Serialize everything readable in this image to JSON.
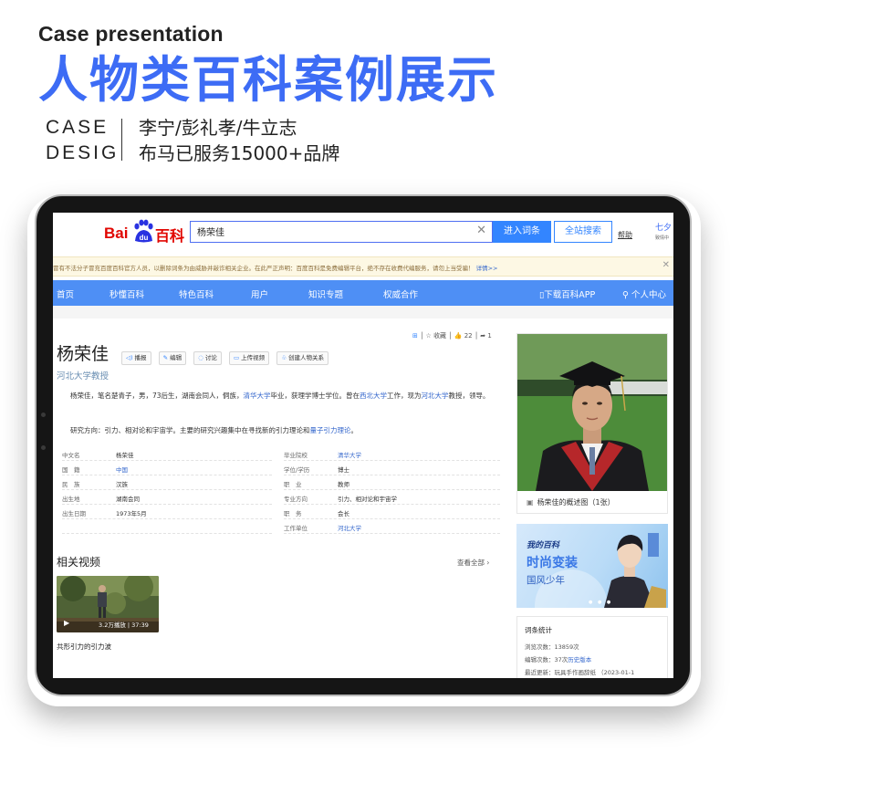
{
  "header": {
    "eyebrow": "Case presentation",
    "headline": "人物类百科案例展示",
    "case_line1": "CASE",
    "case_line2": "DESIG",
    "names": "李宁/彭礼孝/牛立志",
    "served": "布马已服务15000+品牌"
  },
  "baike": {
    "logo_bai": "Bai",
    "logo_du": "du",
    "logo_ke": "百科",
    "search_value": "杨荣佳",
    "enter_button": "进入词条",
    "all_search_button": "全站搜索",
    "help": "帮助",
    "top_right": "七夕",
    "top_right_sub": "致情中",
    "notice": "冒有不法分子冒充百度百科官方人员，以删除词条为由威胁并敲诈相关企业。在此严正声明：百度百科是免费编辑平台，绝不存在收费代编服务，请勿上当受骗！",
    "notice_more": "详情>>",
    "nav": {
      "items": [
        "首页",
        "秒懂百科",
        "特色百科",
        "用户",
        "知识专题",
        "权威合作"
      ],
      "download": "下载百科APP",
      "personal": "个人中心"
    },
    "meta": {
      "collect": "收藏",
      "likes": "22",
      "shares": "1"
    },
    "entry": {
      "name": "杨荣佳",
      "actions": [
        "播报",
        "编辑",
        "讨论",
        "上传视频",
        "创建人物关系"
      ],
      "subtitle": "河北大学教授",
      "intro": {
        "t1": "杨荣佳，笔名楚青子，男，73后生，湖南会同人，侗族，",
        "l1": "清华大学",
        "t2": "毕业，获理学博士学位。曾在",
        "l2": "西北大学",
        "t3": "工作，现为",
        "l3": "河北大学",
        "t4": "教授，领导。"
      },
      "research": {
        "t1": "研究方向：引力、相对论和宇宙学。主要的研究兴趣集中在寻找新的引力理论和",
        "l1": "量子引力理论",
        "t2": "。"
      },
      "info_left": [
        {
          "k": "中文名",
          "v": "杨荣佳",
          "link": false
        },
        {
          "k": "国　籍",
          "v": "中国",
          "link": true
        },
        {
          "k": "民　族",
          "v": "汉族",
          "link": false
        },
        {
          "k": "出生地",
          "v": "湖南会同",
          "link": false
        },
        {
          "k": "出生日期",
          "v": "1973年5月",
          "link": false
        }
      ],
      "info_right": [
        {
          "k": "毕业院校",
          "v": "清华大学",
          "link": true
        },
        {
          "k": "学位/学历",
          "v": "博士",
          "link": false
        },
        {
          "k": "职　业",
          "v": "教师",
          "link": false
        },
        {
          "k": "专业方向",
          "v": "引力、相对论和宇宙学",
          "link": false
        },
        {
          "k": "职　务",
          "v": "会长",
          "link": false
        },
        {
          "k": "工作单位",
          "v": "河北大学",
          "link": true
        }
      ],
      "videos_title": "相关视频",
      "see_all": "查看全部 ›",
      "video_stats": "3.2万播放 | 37:39",
      "video_caption": "共形引力的引力波"
    },
    "sidebar": {
      "photo_caption": "杨荣佳的概述图（1张）",
      "banner_l1": "我的百科",
      "banner_l2": "时尚变装",
      "banner_l3": "国风少年",
      "stats_title": "词条统计",
      "views": "浏览次数：13859次",
      "edits_text": "编辑次数：37次",
      "edits_link": "历史版本",
      "updated": "最近更新：玩具手作画辞纸 （2023-01-1"
    }
  }
}
